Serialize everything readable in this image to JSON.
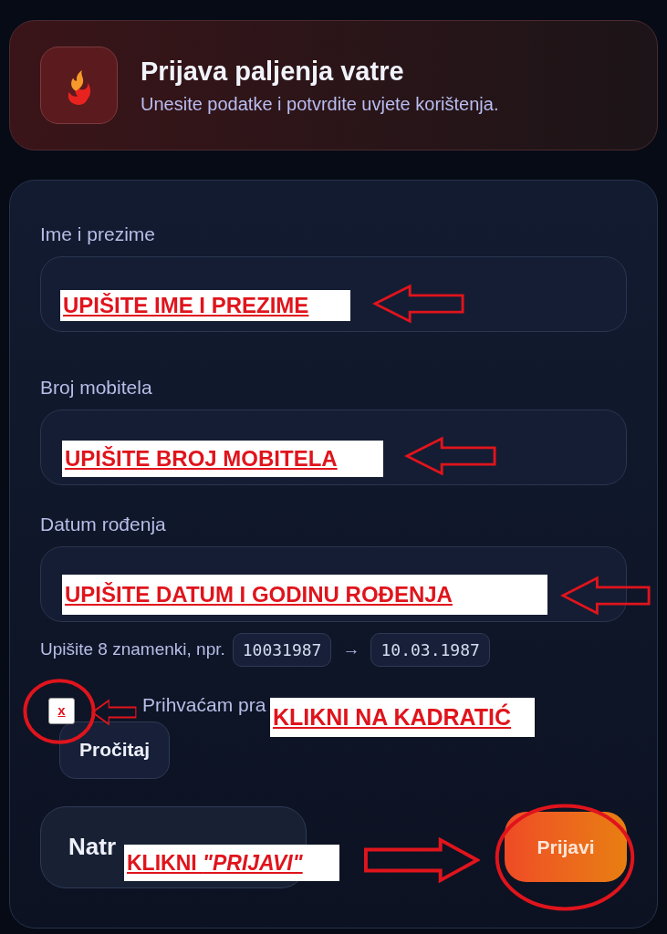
{
  "header": {
    "title": "Prijava paljenja vatre",
    "subtitle": "Unesite podatke i potvrdite uvjete korištenja."
  },
  "fields": [
    {
      "label": "Ime i prezime",
      "note": "UPIŠITE IME I PREZIME"
    },
    {
      "label": "Broj mobitela",
      "note": "UPIŠITE BROJ MOBITELA"
    },
    {
      "label": "Datum rođenja",
      "note": "UPIŠITE DATUM I GODINU ROĐENJA"
    }
  ],
  "hint": {
    "text": "Upišite 8 znamenki, npr.",
    "example_input": "10031987",
    "arrow": "→",
    "example_output": "10.03.1987"
  },
  "terms": {
    "label": "Prihvaćam pra",
    "mark": "x",
    "note": "KLIKNI NA KADRATIĆ",
    "read_button": "Pročitaj"
  },
  "actions": {
    "back": "Natr",
    "submit": "Prijavi",
    "note": "KLIKNI *\"PRIJAVI\"*"
  }
}
